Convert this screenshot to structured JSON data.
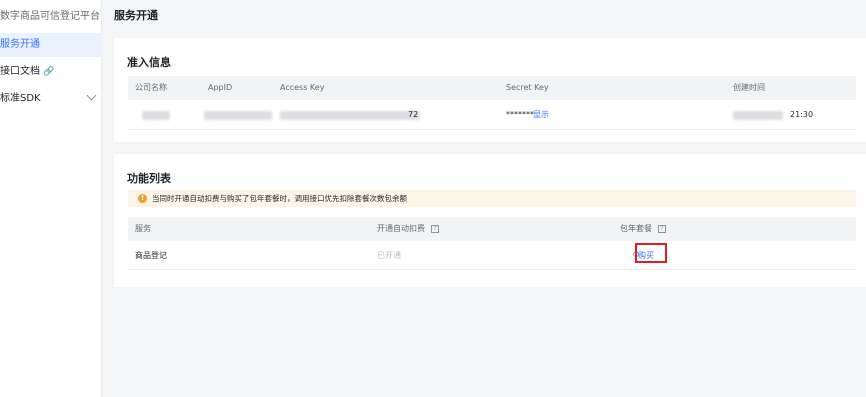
{
  "sidebar": {
    "brand": "数字商品可信登记平台",
    "items": [
      {
        "label": "服务开通",
        "active": true
      },
      {
        "label": "接口文档",
        "icon": "link-icon"
      },
      {
        "label": "标准SDK",
        "icon": "chevron-down-icon"
      }
    ]
  },
  "page": {
    "title": "服务开通"
  },
  "access": {
    "title": "准入信息",
    "columns": [
      "公司名称",
      "AppID",
      "Access Key",
      "Secret Key",
      "创建时间"
    ],
    "row": {
      "access_key_suffix": "72",
      "secret_key_masked": "*******",
      "secret_key_action": "显示",
      "created_time_suffix": "21:30"
    }
  },
  "features": {
    "title": "功能列表",
    "notice": "当同时开通自动扣费与购买了包年套餐时，调用接口优先扣除套餐次数包余额",
    "columns": [
      "服务",
      "开通自动扣费",
      "包年套餐"
    ],
    "rows": [
      {
        "service": "商品登记",
        "auto_pay": "已开通",
        "package_action": "购买"
      }
    ]
  },
  "colors": {
    "accent": "#3370ff",
    "notice_bg": "#fdf3e6",
    "warn": "#f09e2a",
    "highlight": "#e02020"
  }
}
